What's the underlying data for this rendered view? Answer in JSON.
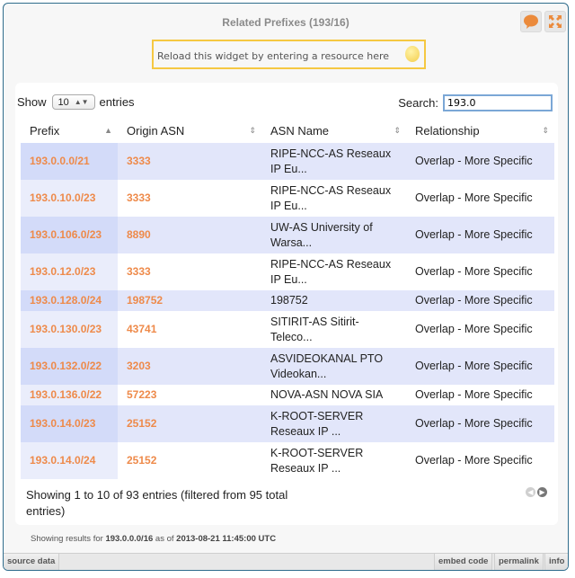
{
  "widget": {
    "title": "Related Prefixes (193/16)",
    "reload_placeholder": "Reload this widget by entering a resource here",
    "icons": {
      "comment": "speech-bubble-icon",
      "expand": "expand-icon",
      "reload": "globe-icon"
    }
  },
  "controls": {
    "show_label": "Show",
    "entries_label": "entries",
    "page_size": "10",
    "search_label": "Search:",
    "search_value": "193.0"
  },
  "table": {
    "columns": [
      {
        "label": "Prefix",
        "sort": "▲"
      },
      {
        "label": "Origin ASN",
        "sort": "⇕"
      },
      {
        "label": "ASN Name",
        "sort": "⇕"
      },
      {
        "label": "Relationship",
        "sort": "⇕"
      }
    ],
    "rows": [
      {
        "prefix": "193.0.0.0/21",
        "asn": "3333",
        "name": [
          "RIPE-NCC-AS Reseaux",
          "IP Eu..."
        ],
        "relationship": "Overlap - More Specific"
      },
      {
        "prefix": "193.0.10.0/23",
        "asn": "3333",
        "name": [
          "RIPE-NCC-AS Reseaux",
          "IP Eu..."
        ],
        "relationship": "Overlap - More Specific"
      },
      {
        "prefix": "193.0.106.0/23",
        "asn": "8890",
        "name": [
          "UW-AS University of",
          "Warsa..."
        ],
        "relationship": "Overlap - More Specific"
      },
      {
        "prefix": "193.0.12.0/23",
        "asn": "3333",
        "name": [
          "RIPE-NCC-AS Reseaux",
          "IP Eu..."
        ],
        "relationship": "Overlap - More Specific"
      },
      {
        "prefix": "193.0.128.0/24",
        "asn": "198752",
        "name": [
          "198752"
        ],
        "relationship": "Overlap - More Specific"
      },
      {
        "prefix": "193.0.130.0/23",
        "asn": "43741",
        "name": [
          "SITIRIT-AS Sitirit-",
          "Teleco..."
        ],
        "relationship": "Overlap - More Specific"
      },
      {
        "prefix": "193.0.132.0/22",
        "asn": "3203",
        "name": [
          "ASVIDEOKANAL PTO",
          "Videokan..."
        ],
        "relationship": "Overlap - More Specific"
      },
      {
        "prefix": "193.0.136.0/22",
        "asn": "57223",
        "name": [
          "NOVA-ASN NOVA SIA"
        ],
        "relationship": "Overlap - More Specific"
      },
      {
        "prefix": "193.0.14.0/23",
        "asn": "25152",
        "name": [
          "K-ROOT-SERVER",
          "Reseaux IP ..."
        ],
        "relationship": "Overlap - More Specific"
      },
      {
        "prefix": "193.0.14.0/24",
        "asn": "25152",
        "name": [
          "K-ROOT-SERVER",
          "Reseaux IP ..."
        ],
        "relationship": "Overlap - More Specific"
      }
    ]
  },
  "pagination": {
    "info": "Showing 1 to 10 of 93 entries (filtered from 95 total entries)",
    "prev": "◀",
    "next": "▶"
  },
  "results": {
    "prefix_text": "Showing results for",
    "resource": "193.0.0.0/16",
    "as_of_text": "as of",
    "timestamp": "2013-08-21 11:45:00 UTC"
  },
  "footer": {
    "source_data": "source data",
    "embed_code": "embed code",
    "permalink": "permalink",
    "info": "info"
  }
}
